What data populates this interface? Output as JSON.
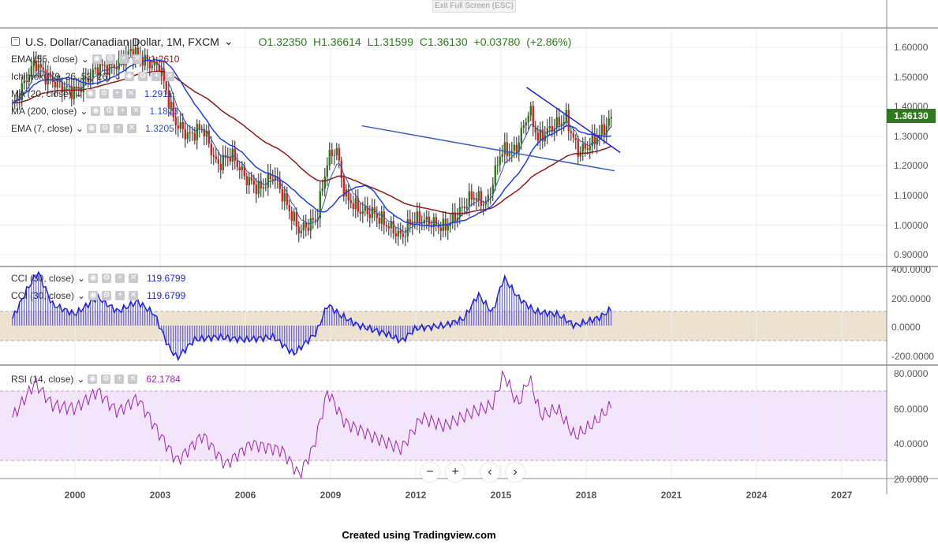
{
  "toolbar": {
    "exit_fullscreen": "Exit Full Screen (ESC)"
  },
  "symbol": {
    "title": "U.S. Dollar/Canadian Dollar, 1M, FXCM",
    "open": "O1.32350",
    "high": "H1.36614",
    "low": "L1.31599",
    "close": "C1.36130",
    "change": "+0.03780 (+2.86%)",
    "last_price": "1.36130"
  },
  "indicators": [
    {
      "label": "EMA (55, close)",
      "value": "1.2610",
      "color": "#8b1a1a"
    },
    {
      "label": "Ichimoku (9, 26, 52, 26)",
      "value": "",
      "color": "#999999"
    },
    {
      "label": "MA (20, close)",
      "value": "1.2911",
      "color": "#1f3fe0"
    },
    {
      "label": "MA (200, close)",
      "value": "1.1823",
      "color": "#3355cc"
    },
    {
      "label": "EMA (7, close)",
      "value": "1.3205",
      "color": "#3355aa"
    },
    {
      "label": "CCI (30, close)",
      "value": "119.6799",
      "color": "#1f1fe0"
    },
    {
      "label": "CCI (30, close)",
      "value": "119.6799",
      "color": "#1f1fe0"
    },
    {
      "label": "RSI (14, close)",
      "value": "62.1784",
      "color": "#9c27b0"
    }
  ],
  "price_axis": [
    "1.60000",
    "1.50000",
    "1.40000",
    "1.30000",
    "1.20000",
    "1.10000",
    "1.00000",
    "0.90000"
  ],
  "cci_axis": [
    "400.0000",
    "200.0000",
    "0.0000",
    "-200.0000"
  ],
  "rsi_axis": [
    "80.0000",
    "60.0000",
    "40.0000",
    "20.0000"
  ],
  "time_axis": [
    "2000",
    "2003",
    "2006",
    "2009",
    "2012",
    "2015",
    "2018",
    "2021",
    "2024",
    "2027"
  ],
  "nav": {
    "zoom_out": "−",
    "zoom_in": "+",
    "left": "‹",
    "right": "›"
  },
  "footer": "Created using Tradingview.com",
  "colors": {
    "up": "#2f7a1e",
    "down": "#e02020",
    "accent": "#2f7a1e"
  },
  "chart_data": {
    "type": "line",
    "price_anchors": [
      [
        1997.8,
        1.4
      ],
      [
        1998.6,
        1.55
      ],
      [
        1999.0,
        1.5
      ],
      [
        1999.5,
        1.47
      ],
      [
        2000.0,
        1.45
      ],
      [
        2000.8,
        1.53
      ],
      [
        2001.5,
        1.54
      ],
      [
        2002.0,
        1.59
      ],
      [
        2002.5,
        1.55
      ],
      [
        2003.0,
        1.53
      ],
      [
        2003.5,
        1.35
      ],
      [
        2004.0,
        1.3
      ],
      [
        2004.5,
        1.33
      ],
      [
        2005.0,
        1.2
      ],
      [
        2005.5,
        1.24
      ],
      [
        2006.0,
        1.16
      ],
      [
        2006.5,
        1.12
      ],
      [
        2007.0,
        1.17
      ],
      [
        2007.5,
        1.06
      ],
      [
        2007.9,
        0.98
      ],
      [
        2008.5,
        1.02
      ],
      [
        2008.9,
        1.22
      ],
      [
        2009.2,
        1.26
      ],
      [
        2009.5,
        1.1
      ],
      [
        2010.0,
        1.05
      ],
      [
        2010.5,
        1.04
      ],
      [
        2011.0,
        1.0
      ],
      [
        2011.5,
        0.96
      ],
      [
        2011.9,
        1.02
      ],
      [
        2012.5,
        1.01
      ],
      [
        2013.0,
        0.99
      ],
      [
        2013.5,
        1.04
      ],
      [
        2014.0,
        1.1
      ],
      [
        2014.5,
        1.07
      ],
      [
        2015.0,
        1.25
      ],
      [
        2015.5,
        1.25
      ],
      [
        2016.0,
        1.39
      ],
      [
        2016.3,
        1.29
      ],
      [
        2016.8,
        1.33
      ],
      [
        2017.3,
        1.36
      ],
      [
        2017.7,
        1.25
      ],
      [
        2018.0,
        1.26
      ],
      [
        2018.5,
        1.31
      ],
      [
        2018.9,
        1.36
      ]
    ],
    "cci_anchors": [
      [
        1997.8,
        50
      ],
      [
        1998.3,
        250
      ],
      [
        1998.7,
        380
      ],
      [
        1999.2,
        150
      ],
      [
        2000,
        80
      ],
      [
        2000.8,
        200
      ],
      [
        2001.5,
        100
      ],
      [
        2002.2,
        170
      ],
      [
        2002.8,
        80
      ],
      [
        2003.3,
        -150
      ],
      [
        2003.6,
        -230
      ],
      [
        2004.2,
        -100
      ],
      [
        2005,
        -80
      ],
      [
        2006,
        -100
      ],
      [
        2007,
        -80
      ],
      [
        2007.7,
        -200
      ],
      [
        2008.5,
        -50
      ],
      [
        2008.9,
        150
      ],
      [
        2009.3,
        80
      ],
      [
        2010,
        0
      ],
      [
        2011,
        -60
      ],
      [
        2011.5,
        -110
      ],
      [
        2012,
        -20
      ],
      [
        2013,
        0
      ],
      [
        2013.7,
        50
      ],
      [
        2014.2,
        220
      ],
      [
        2014.7,
        90
      ],
      [
        2015.1,
        340
      ],
      [
        2015.6,
        200
      ],
      [
        2016.2,
        100
      ],
      [
        2017,
        80
      ],
      [
        2017.6,
        0
      ],
      [
        2018.5,
        60
      ],
      [
        2018.9,
        120
      ]
    ],
    "rsi_anchors": [
      [
        1997.8,
        55
      ],
      [
        1998.6,
        75
      ],
      [
        1999.2,
        62
      ],
      [
        2000,
        60
      ],
      [
        2000.8,
        70
      ],
      [
        2001.5,
        58
      ],
      [
        2002.2,
        66
      ],
      [
        2003,
        45
      ],
      [
        2003.6,
        30
      ],
      [
        2004.5,
        45
      ],
      [
        2005.3,
        28
      ],
      [
        2006.2,
        40
      ],
      [
        2007.3,
        36
      ],
      [
        2007.9,
        22
      ],
      [
        2008.4,
        38
      ],
      [
        2008.9,
        70
      ],
      [
        2009.5,
        52
      ],
      [
        2010.5,
        44
      ],
      [
        2011.5,
        37
      ],
      [
        2012.2,
        55
      ],
      [
        2013,
        50
      ],
      [
        2014,
        58
      ],
      [
        2014.7,
        62
      ],
      [
        2015.1,
        80
      ],
      [
        2015.6,
        62
      ],
      [
        2016,
        78
      ],
      [
        2016.4,
        56
      ],
      [
        2017,
        60
      ],
      [
        2017.6,
        44
      ],
      [
        2018.3,
        52
      ],
      [
        2018.9,
        62
      ]
    ],
    "trendlines": [
      {
        "from": [
          2015.9,
          1.465
        ],
        "to": [
          2019.2,
          1.245
        ]
      },
      {
        "from": [
          2010.1,
          1.335
        ],
        "to": [
          2019.0,
          1.183
        ]
      }
    ],
    "price_range": [
      0.9,
      1.6
    ],
    "cci_range": [
      -200,
      400
    ],
    "rsi_range": [
      20,
      80
    ],
    "rsi_band": [
      30,
      70
    ],
    "cci_band": [
      -100,
      100
    ]
  }
}
